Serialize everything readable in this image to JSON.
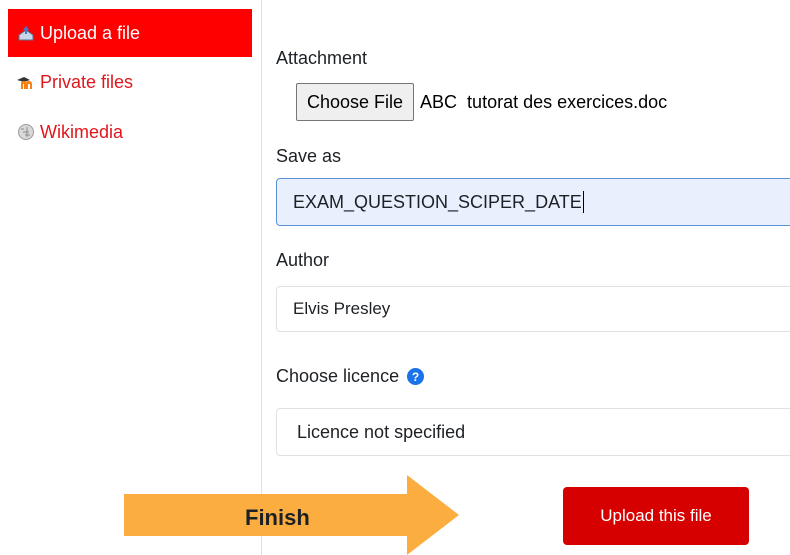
{
  "sidebar": {
    "items": [
      {
        "label": "Upload a file",
        "icon": "upload-icon",
        "active": true
      },
      {
        "label": "Private files",
        "icon": "moodle-icon",
        "active": false
      },
      {
        "label": "Wikimedia",
        "icon": "wikimedia-icon",
        "active": false
      }
    ]
  },
  "form": {
    "attachment_label": "Attachment",
    "choose_file_label": "Choose File",
    "chosen_file_name": "ABC  tutorat des exercices.doc",
    "save_as_label": "Save as",
    "save_as_value": "EXAM_QUESTION_SCIPER_DATE",
    "author_label": "Author",
    "author_value": "Elvis Presley",
    "licence_label": "Choose licence",
    "licence_value": "Licence not specified",
    "upload_button_label": "Upload this file"
  },
  "annotation": {
    "finish_label": "Finish"
  },
  "colors": {
    "sidebar_active_bg": "#ff0000",
    "sidebar_link": "#e0161d",
    "upload_button_bg": "#d60000",
    "arrow_fill": "#fbae3f",
    "save_as_bg": "#e8f0fe",
    "help_icon": "#1a73e8"
  }
}
